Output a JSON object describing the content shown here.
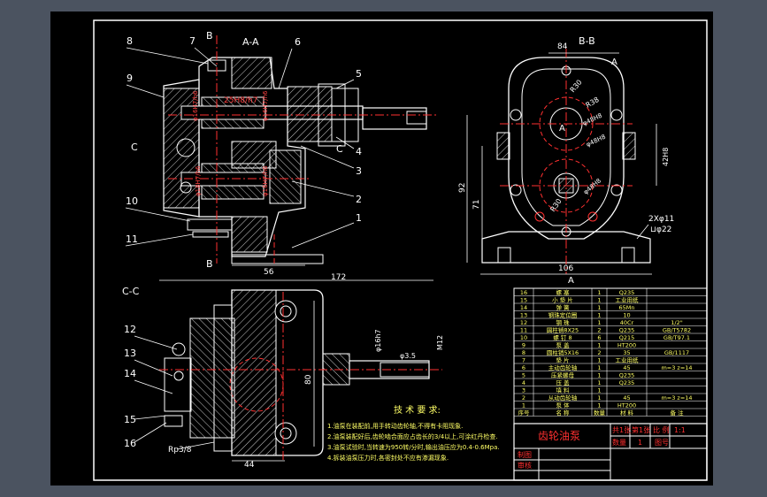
{
  "views": {
    "section_aa": "A-A",
    "section_bb": "B-B",
    "section_cc": "C-C",
    "cut_a": "A",
    "cut_b": "B",
    "cut_c": "C"
  },
  "balloons": [
    "1",
    "2",
    "3",
    "4",
    "5",
    "6",
    "7",
    "8",
    "9",
    "10",
    "11",
    "12",
    "13",
    "14",
    "15",
    "16"
  ],
  "dims_aa": {
    "d1": "25H8/h7",
    "d2": "φ16H7/h6",
    "d3": "φ16H7/h6",
    "d4": "φ16H7/h6",
    "d5": "φ18H7/h6",
    "w56": "56"
  },
  "dims_bb": {
    "w84": "84",
    "r1": "R30",
    "r2": "R38",
    "r3": "φ48H8",
    "r4": "φ48H8",
    "r5": "R30",
    "r6": "φ48H8",
    "h42": "42H8",
    "h92": "92",
    "h71": "71",
    "w106": "106",
    "holes": "2Xφ11",
    "depth": "⊔φ22"
  },
  "dims_cc": {
    "w172": "172",
    "h80": "80",
    "w44": "44",
    "thread": "M12",
    "d16": "φ16h7",
    "d35": "φ3.5",
    "rp": "Rp3/8"
  },
  "tech": {
    "title": "技 术 要 求:",
    "lines": [
      "1.油泵在装配前,用手转动齿轮轴,不得有卡阻现象.",
      "2.油泵装配好后,齿轮啮合面应占齿长的3/4以上,可涂红丹检查.",
      "3.油泵试验时,当转速为950转/分时,输出油压应为0.4-0.6Mpa.",
      "4.拆装油泵压力时,各密封处不应有渗漏现象."
    ]
  },
  "bom": [
    {
      "no": "16",
      "name": "螺 塞",
      "qty": "1",
      "mat": "Q235",
      "note": ""
    },
    {
      "no": "15",
      "name": "小 垫 片",
      "qty": "1",
      "mat": "工业用纸",
      "note": ""
    },
    {
      "no": "14",
      "name": "弹 簧",
      "qty": "1",
      "mat": "65Mn",
      "note": ""
    },
    {
      "no": "13",
      "name": "钢珠定位圈",
      "qty": "1",
      "mat": "10",
      "note": ""
    },
    {
      "no": "12",
      "name": "钢 珠",
      "qty": "1",
      "mat": "40Cr",
      "note": "1/2\""
    },
    {
      "no": "11",
      "name": "圆柱销8X25",
      "qty": "2",
      "mat": "Q235",
      "note": "GB/T5782"
    },
    {
      "no": "10",
      "name": "螺 钉 8",
      "qty": "6",
      "mat": "Q215",
      "note": "GB/T97.1"
    },
    {
      "no": "9",
      "name": "泵 盖",
      "qty": "1",
      "mat": "HT200",
      "note": ""
    },
    {
      "no": "8",
      "name": "圆柱销5X16",
      "qty": "2",
      "mat": "35",
      "note": "GB/1117"
    },
    {
      "no": "7",
      "name": "垫 片",
      "qty": "1",
      "mat": "工业用纸",
      "note": ""
    },
    {
      "no": "6",
      "name": "主动齿轮轴",
      "qty": "1",
      "mat": "45",
      "note": "m=3 z=14"
    },
    {
      "no": "5",
      "name": "压紧螺母",
      "qty": "1",
      "mat": "Q235",
      "note": ""
    },
    {
      "no": "4",
      "name": "压 盖",
      "qty": "1",
      "mat": "Q235",
      "note": ""
    },
    {
      "no": "3",
      "name": "填 料",
      "qty": "1",
      "mat": "",
      "note": ""
    },
    {
      "no": "2",
      "name": "从动齿轮轴",
      "qty": "1",
      "mat": "45",
      "note": "m=3 z=14"
    },
    {
      "no": "1",
      "name": "泵 体",
      "qty": "1",
      "mat": "HT200",
      "note": ""
    }
  ],
  "bom_header": {
    "no": "序号",
    "name": "名 称",
    "qty": "数量",
    "mat": "材 料",
    "note": "备 注"
  },
  "title_block": {
    "title": "齿轮油泵",
    "sheet": "共1张",
    "page": "第1张",
    "scale_label": "比 例",
    "scale": "1:1",
    "qty_label": "数量",
    "qty": "1",
    "drawing_no": "图号",
    "drawn": "制图",
    "checked": "审核"
  }
}
